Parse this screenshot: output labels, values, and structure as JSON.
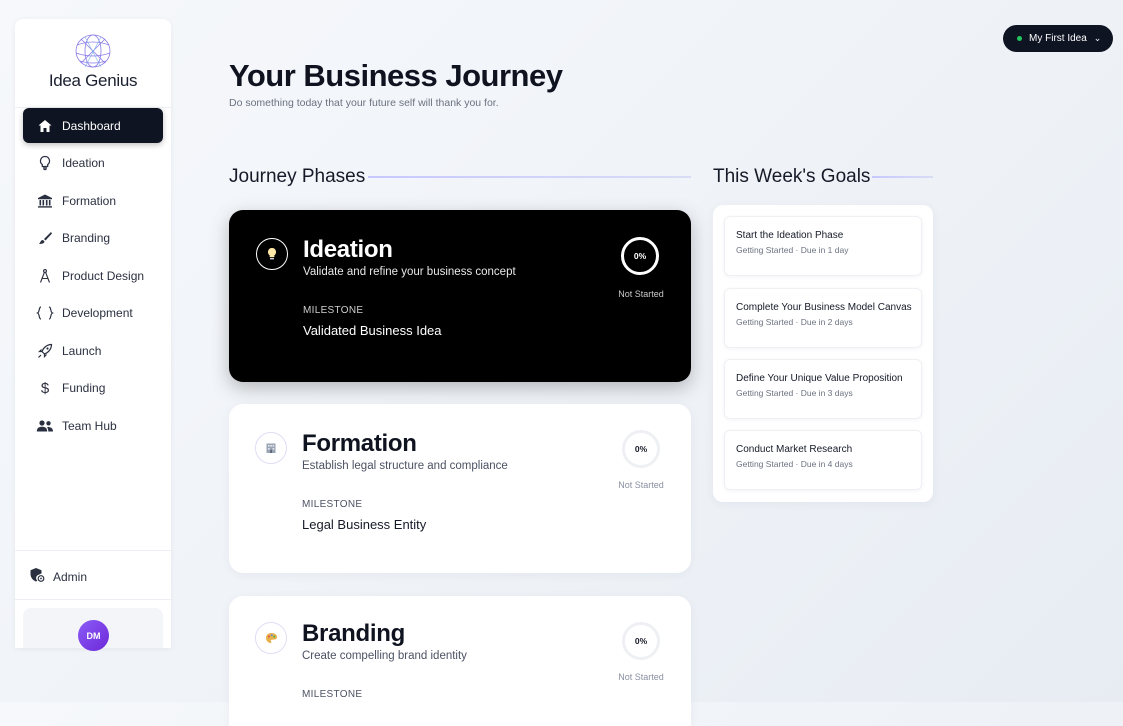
{
  "app": {
    "name": "Idea Genius"
  },
  "sidebar": {
    "items": [
      {
        "label": "Dashboard",
        "icon": "home-icon",
        "active": true
      },
      {
        "label": "Ideation",
        "icon": "lightbulb-icon",
        "active": false
      },
      {
        "label": "Formation",
        "icon": "bank-icon",
        "active": false
      },
      {
        "label": "Branding",
        "icon": "brush-icon",
        "active": false
      },
      {
        "label": "Product Design",
        "icon": "compass-icon",
        "active": false
      },
      {
        "label": "Development",
        "icon": "code-braces-icon",
        "active": false
      },
      {
        "label": "Launch",
        "icon": "rocket-icon",
        "active": false
      },
      {
        "label": "Funding",
        "icon": "dollar-icon",
        "active": false
      },
      {
        "label": "Team Hub",
        "icon": "team-icon",
        "active": false
      }
    ],
    "admin_label": "Admin",
    "user": {
      "initials": "DM"
    }
  },
  "header": {
    "title": "Your Business Journey",
    "subtitle": "Do something today that your future self will thank you for.",
    "idea_selector": "My First Idea"
  },
  "journey": {
    "section_title": "Journey Phases",
    "phases": [
      {
        "name": "Ideation",
        "description": "Validate and refine your business concept",
        "milestone_label": "MILESTONE",
        "milestone": "Validated Business Idea",
        "progress": "0%",
        "status": "Not Started",
        "icon": "lightbulb-icon"
      },
      {
        "name": "Formation",
        "description": "Establish legal structure and compliance",
        "milestone_label": "MILESTONE",
        "milestone": "Legal Business Entity",
        "progress": "0%",
        "status": "Not Started",
        "icon": "building-icon"
      },
      {
        "name": "Branding",
        "description": "Create compelling brand identity",
        "milestone_label": "MILESTONE",
        "milestone": "",
        "progress": "0%",
        "status": "Not Started",
        "icon": "palette-icon"
      }
    ]
  },
  "goals": {
    "section_title": "This Week's Goals",
    "items": [
      {
        "title": "Start the Ideation Phase",
        "meta": "Getting Started · Due in 1 day"
      },
      {
        "title": "Complete Your Business Model Canvas",
        "meta": "Getting Started · Due in 2 days"
      },
      {
        "title": "Define Your Unique Value Proposition",
        "meta": "Getting Started · Due in 3 days"
      },
      {
        "title": "Conduct Market Research",
        "meta": "Getting Started · Due in 4 days"
      }
    ]
  },
  "colors": {
    "accent_dark": "#0f1422",
    "avatar_purple": "#7c3aed",
    "status_green": "#22c55e",
    "section_line": "#c8c8ff"
  }
}
